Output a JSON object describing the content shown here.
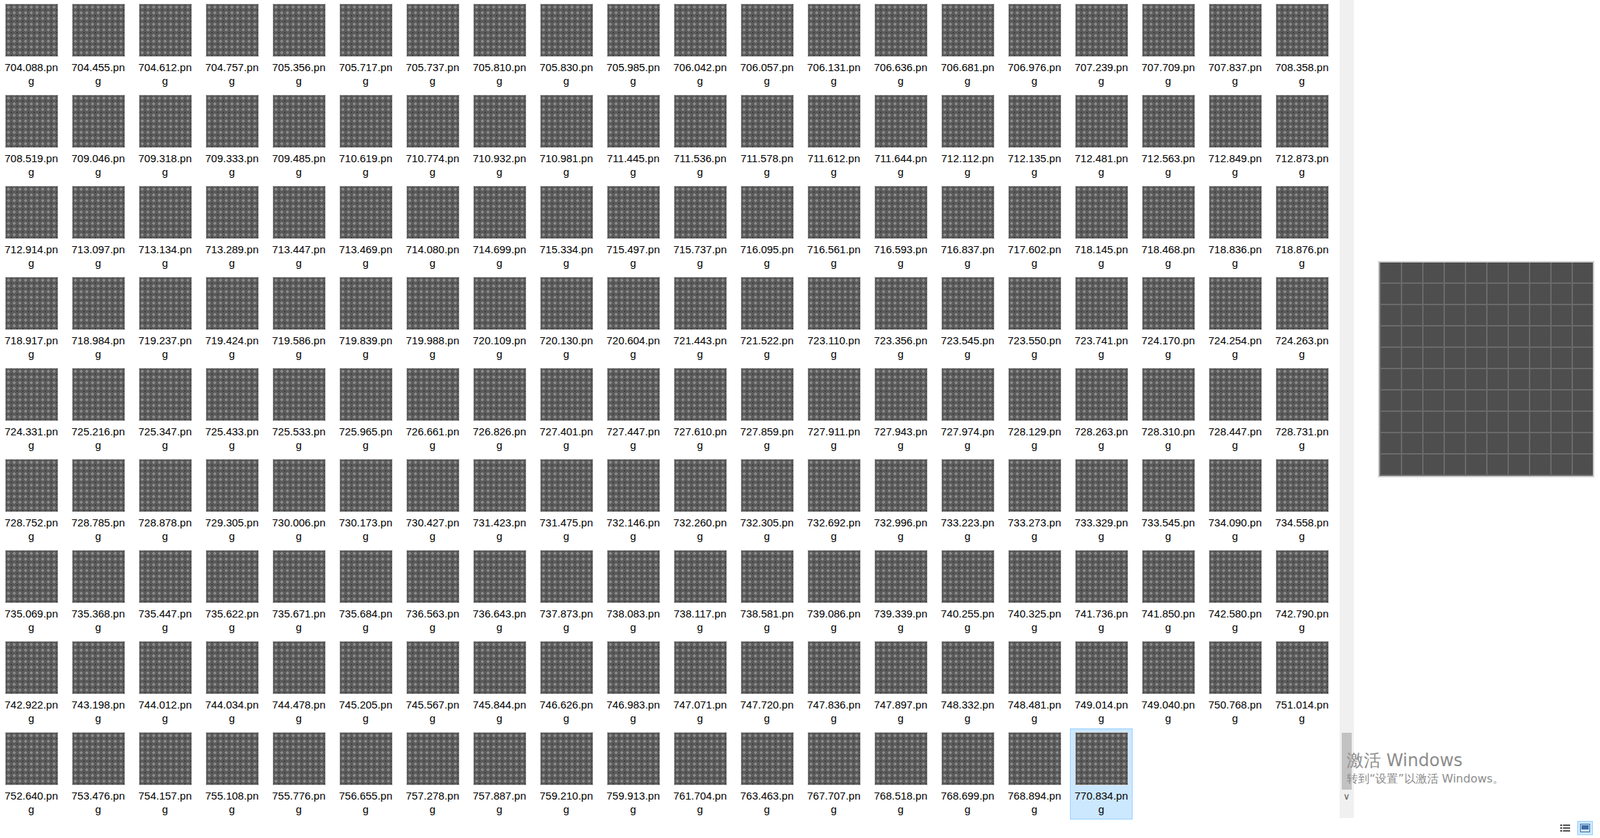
{
  "files": [
    {
      "name": "704.088.png",
      "selected": false
    },
    {
      "name": "704.455.png",
      "selected": false
    },
    {
      "name": "704.612.png",
      "selected": false
    },
    {
      "name": "704.757.png",
      "selected": false
    },
    {
      "name": "705.356.png",
      "selected": false
    },
    {
      "name": "705.717.png",
      "selected": false
    },
    {
      "name": "705.737.png",
      "selected": false
    },
    {
      "name": "705.810.png",
      "selected": false
    },
    {
      "name": "705.830.png",
      "selected": false
    },
    {
      "name": "705.985.png",
      "selected": false
    },
    {
      "name": "706.042.png",
      "selected": false
    },
    {
      "name": "706.057.png",
      "selected": false
    },
    {
      "name": "706.131.png",
      "selected": false
    },
    {
      "name": "706.636.png",
      "selected": false
    },
    {
      "name": "706.681.png",
      "selected": false
    },
    {
      "name": "706.976.png",
      "selected": false
    },
    {
      "name": "707.239.png",
      "selected": false
    },
    {
      "name": "707.709.png",
      "selected": false
    },
    {
      "name": "707.837.png",
      "selected": false
    },
    {
      "name": "708.358.png",
      "selected": false
    },
    {
      "name": "708.519.png",
      "selected": false
    },
    {
      "name": "709.046.png",
      "selected": false
    },
    {
      "name": "709.318.png",
      "selected": false
    },
    {
      "name": "709.333.png",
      "selected": false
    },
    {
      "name": "709.485.png",
      "selected": false
    },
    {
      "name": "710.619.png",
      "selected": false
    },
    {
      "name": "710.774.png",
      "selected": false
    },
    {
      "name": "710.932.png",
      "selected": false
    },
    {
      "name": "710.981.png",
      "selected": false
    },
    {
      "name": "711.445.png",
      "selected": false
    },
    {
      "name": "711.536.png",
      "selected": false
    },
    {
      "name": "711.578.png",
      "selected": false
    },
    {
      "name": "711.612.png",
      "selected": false
    },
    {
      "name": "711.644.png",
      "selected": false
    },
    {
      "name": "712.112.png",
      "selected": false
    },
    {
      "name": "712.135.png",
      "selected": false
    },
    {
      "name": "712.481.png",
      "selected": false
    },
    {
      "name": "712.563.png",
      "selected": false
    },
    {
      "name": "712.849.png",
      "selected": false
    },
    {
      "name": "712.873.png",
      "selected": false
    },
    {
      "name": "712.914.png",
      "selected": false
    },
    {
      "name": "713.097.png",
      "selected": false
    },
    {
      "name": "713.134.png",
      "selected": false
    },
    {
      "name": "713.289.png",
      "selected": false
    },
    {
      "name": "713.447.png",
      "selected": false
    },
    {
      "name": "713.469.png",
      "selected": false
    },
    {
      "name": "714.080.png",
      "selected": false
    },
    {
      "name": "714.699.png",
      "selected": false
    },
    {
      "name": "715.334.png",
      "selected": false
    },
    {
      "name": "715.497.png",
      "selected": false
    },
    {
      "name": "715.737.png",
      "selected": false
    },
    {
      "name": "716.095.png",
      "selected": false
    },
    {
      "name": "716.561.png",
      "selected": false
    },
    {
      "name": "716.593.png",
      "selected": false
    },
    {
      "name": "716.837.png",
      "selected": false
    },
    {
      "name": "717.602.png",
      "selected": false
    },
    {
      "name": "718.145.png",
      "selected": false
    },
    {
      "name": "718.468.png",
      "selected": false
    },
    {
      "name": "718.836.png",
      "selected": false
    },
    {
      "name": "718.876.png",
      "selected": false
    },
    {
      "name": "718.917.png",
      "selected": false
    },
    {
      "name": "718.984.png",
      "selected": false
    },
    {
      "name": "719.237.png",
      "selected": false
    },
    {
      "name": "719.424.png",
      "selected": false
    },
    {
      "name": "719.586.png",
      "selected": false
    },
    {
      "name": "719.839.png",
      "selected": false
    },
    {
      "name": "719.988.png",
      "selected": false
    },
    {
      "name": "720.109.png",
      "selected": false
    },
    {
      "name": "720.130.png",
      "selected": false
    },
    {
      "name": "720.604.png",
      "selected": false
    },
    {
      "name": "721.443.png",
      "selected": false
    },
    {
      "name": "721.522.png",
      "selected": false
    },
    {
      "name": "723.110.png",
      "selected": false
    },
    {
      "name": "723.356.png",
      "selected": false
    },
    {
      "name": "723.545.png",
      "selected": false
    },
    {
      "name": "723.550.png",
      "selected": false
    },
    {
      "name": "723.741.png",
      "selected": false
    },
    {
      "name": "724.170.png",
      "selected": false
    },
    {
      "name": "724.254.png",
      "selected": false
    },
    {
      "name": "724.263.png",
      "selected": false
    },
    {
      "name": "724.331.png",
      "selected": false
    },
    {
      "name": "725.216.png",
      "selected": false
    },
    {
      "name": "725.347.png",
      "selected": false
    },
    {
      "name": "725.433.png",
      "selected": false
    },
    {
      "name": "725.533.png",
      "selected": false
    },
    {
      "name": "725.965.png",
      "selected": false
    },
    {
      "name": "726.661.png",
      "selected": false
    },
    {
      "name": "726.826.png",
      "selected": false
    },
    {
      "name": "727.401.png",
      "selected": false
    },
    {
      "name": "727.447.png",
      "selected": false
    },
    {
      "name": "727.610.png",
      "selected": false
    },
    {
      "name": "727.859.png",
      "selected": false
    },
    {
      "name": "727.911.png",
      "selected": false
    },
    {
      "name": "727.943.png",
      "selected": false
    },
    {
      "name": "727.974.png",
      "selected": false
    },
    {
      "name": "728.129.png",
      "selected": false
    },
    {
      "name": "728.263.png",
      "selected": false
    },
    {
      "name": "728.310.png",
      "selected": false
    },
    {
      "name": "728.447.png",
      "selected": false
    },
    {
      "name": "728.731.png",
      "selected": false
    },
    {
      "name": "728.752.png",
      "selected": false
    },
    {
      "name": "728.785.png",
      "selected": false
    },
    {
      "name": "728.878.png",
      "selected": false
    },
    {
      "name": "729.305.png",
      "selected": false
    },
    {
      "name": "730.006.png",
      "selected": false
    },
    {
      "name": "730.173.png",
      "selected": false
    },
    {
      "name": "730.427.png",
      "selected": false
    },
    {
      "name": "731.423.png",
      "selected": false
    },
    {
      "name": "731.475.png",
      "selected": false
    },
    {
      "name": "732.146.png",
      "selected": false
    },
    {
      "name": "732.260.png",
      "selected": false
    },
    {
      "name": "732.305.png",
      "selected": false
    },
    {
      "name": "732.692.png",
      "selected": false
    },
    {
      "name": "732.996.png",
      "selected": false
    },
    {
      "name": "733.223.png",
      "selected": false
    },
    {
      "name": "733.273.png",
      "selected": false
    },
    {
      "name": "733.329.png",
      "selected": false
    },
    {
      "name": "733.545.png",
      "selected": false
    },
    {
      "name": "734.090.png",
      "selected": false
    },
    {
      "name": "734.558.png",
      "selected": false
    },
    {
      "name": "735.069.png",
      "selected": false
    },
    {
      "name": "735.368.png",
      "selected": false
    },
    {
      "name": "735.447.png",
      "selected": false
    },
    {
      "name": "735.622.png",
      "selected": false
    },
    {
      "name": "735.671.png",
      "selected": false
    },
    {
      "name": "735.684.png",
      "selected": false
    },
    {
      "name": "736.563.png",
      "selected": false
    },
    {
      "name": "736.643.png",
      "selected": false
    },
    {
      "name": "737.873.png",
      "selected": false
    },
    {
      "name": "738.083.png",
      "selected": false
    },
    {
      "name": "738.117.png",
      "selected": false
    },
    {
      "name": "738.581.png",
      "selected": false
    },
    {
      "name": "739.086.png",
      "selected": false
    },
    {
      "name": "739.339.png",
      "selected": false
    },
    {
      "name": "740.255.png",
      "selected": false
    },
    {
      "name": "740.325.png",
      "selected": false
    },
    {
      "name": "741.736.png",
      "selected": false
    },
    {
      "name": "741.850.png",
      "selected": false
    },
    {
      "name": "742.580.png",
      "selected": false
    },
    {
      "name": "742.790.png",
      "selected": false
    },
    {
      "name": "742.922.png",
      "selected": false
    },
    {
      "name": "743.198.png",
      "selected": false
    },
    {
      "name": "744.012.png",
      "selected": false
    },
    {
      "name": "744.034.png",
      "selected": false
    },
    {
      "name": "744.478.png",
      "selected": false
    },
    {
      "name": "745.205.png",
      "selected": false
    },
    {
      "name": "745.567.png",
      "selected": false
    },
    {
      "name": "745.844.png",
      "selected": false
    },
    {
      "name": "746.626.png",
      "selected": false
    },
    {
      "name": "746.983.png",
      "selected": false
    },
    {
      "name": "747.071.png",
      "selected": false
    },
    {
      "name": "747.720.png",
      "selected": false
    },
    {
      "name": "747.836.png",
      "selected": false
    },
    {
      "name": "747.897.png",
      "selected": false
    },
    {
      "name": "748.332.png",
      "selected": false
    },
    {
      "name": "748.481.png",
      "selected": false
    },
    {
      "name": "749.014.png",
      "selected": false
    },
    {
      "name": "749.040.png",
      "selected": false
    },
    {
      "name": "750.768.png",
      "selected": false
    },
    {
      "name": "751.014.png",
      "selected": false
    },
    {
      "name": "752.640.png",
      "selected": false
    },
    {
      "name": "753.476.png",
      "selected": false
    },
    {
      "name": "754.157.png",
      "selected": false
    },
    {
      "name": "755.108.png",
      "selected": false
    },
    {
      "name": "755.776.png",
      "selected": false
    },
    {
      "name": "756.655.png",
      "selected": false
    },
    {
      "name": "757.278.png",
      "selected": false
    },
    {
      "name": "757.887.png",
      "selected": false
    },
    {
      "name": "759.210.png",
      "selected": false
    },
    {
      "name": "759.913.png",
      "selected": false
    },
    {
      "name": "761.704.png",
      "selected": false
    },
    {
      "name": "763.463.png",
      "selected": false
    },
    {
      "name": "767.707.png",
      "selected": false
    },
    {
      "name": "768.518.png",
      "selected": false
    },
    {
      "name": "768.699.png",
      "selected": false
    },
    {
      "name": "768.894.png",
      "selected": false
    },
    {
      "name": "770.834.png",
      "selected": true
    }
  ],
  "scrollbar": {
    "level": 1,
    "arrow": "∨"
  },
  "watermark": {
    "title": "激活 Windows",
    "subtitle": "转到“设置”以激活 Windows。"
  },
  "view_buttons": [
    {
      "selected": false
    },
    {
      "selected": true
    }
  ]
}
